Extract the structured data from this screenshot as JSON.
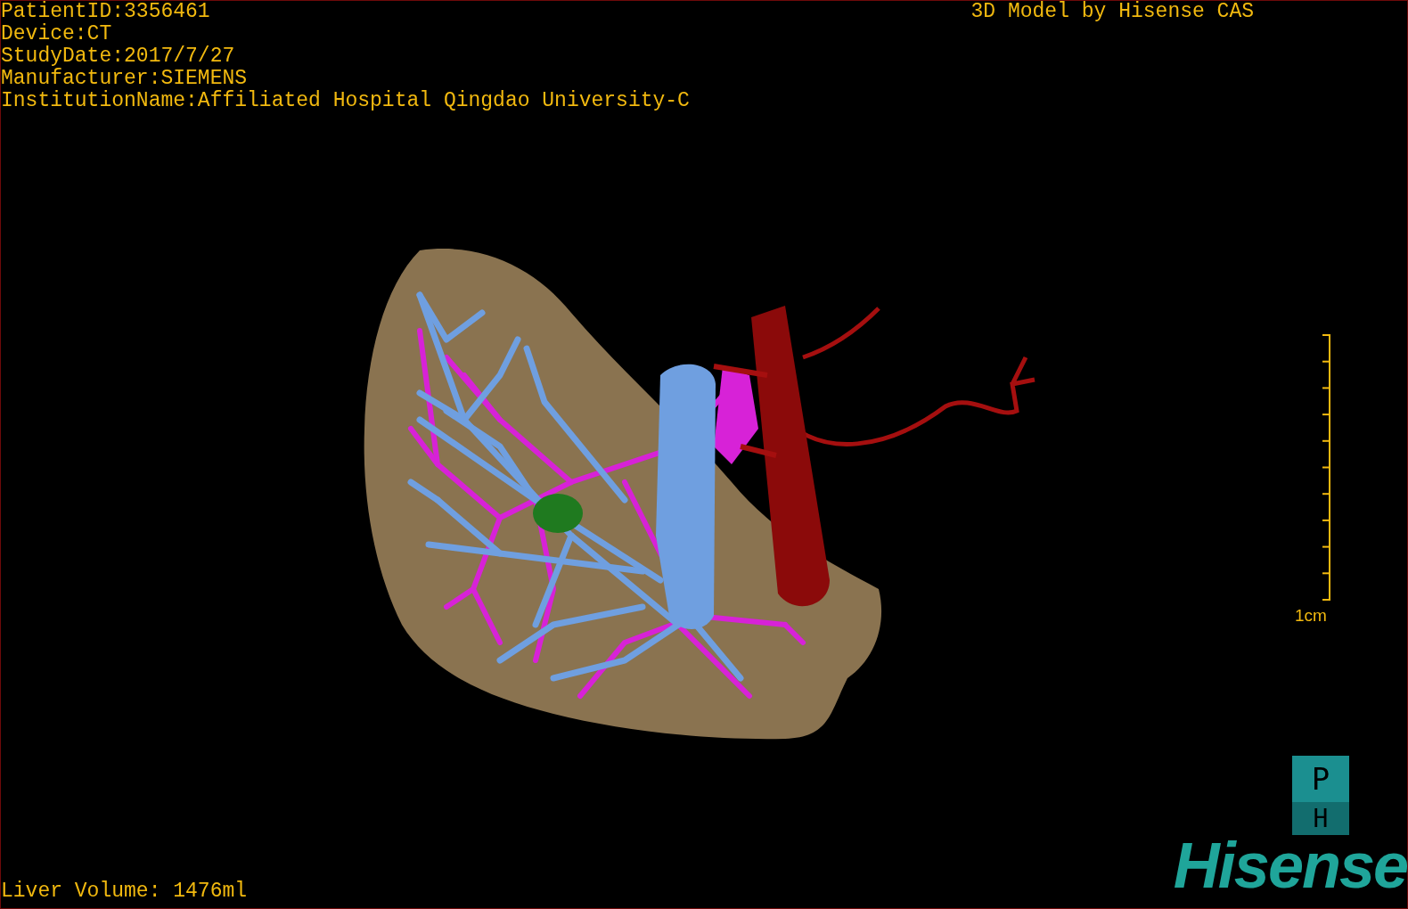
{
  "info_lines": [
    "PatientID:3356461",
    "Device:CT",
    "StudyDate:2017/7/27",
    "Manufacturer:SIEMENS",
    "InstitutionName:Affiliated Hospital Qingdao University-C"
  ],
  "title": "3D Model by Hisense CAS",
  "scale_bar": {
    "label": "1cm"
  },
  "orientation_cube": {
    "top": "P",
    "bottom": "H"
  },
  "logo": "Hisense",
  "status": "Liver Volume: 1476ml"
}
